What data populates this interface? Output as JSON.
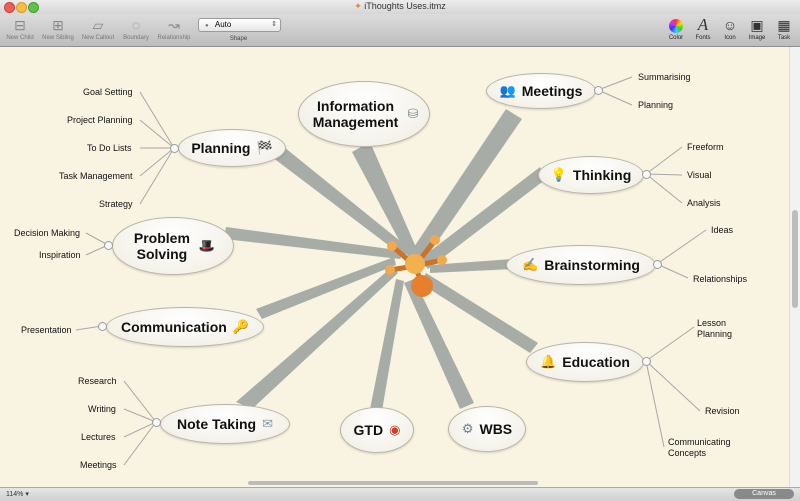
{
  "window": {
    "title": "iThoughts Uses.itmz"
  },
  "toolbar": {
    "new_child": "New Child",
    "new_sibling": "New Sibling",
    "new_callout": "New Callout",
    "boundary": "Boundary",
    "relationship": "Relationship",
    "shape_value": "Auto",
    "shape_label": "Shape",
    "color": "Color",
    "fonts": "Fonts",
    "icon": "Icon",
    "image": "Image",
    "task": "Task"
  },
  "mindmap": {
    "branches": {
      "information_management": {
        "label": "Information Management",
        "icon": "database-icon"
      },
      "meetings": {
        "label": "Meetings",
        "icon": "people-icon",
        "children": [
          "Summarising",
          "Planning"
        ]
      },
      "thinking": {
        "label": "Thinking",
        "icon": "lightbulb-icon",
        "children": [
          "Freeform",
          "Visual",
          "Analysis"
        ]
      },
      "brainstorming": {
        "label": "Brainstorming",
        "icon": "pencil-icon",
        "children": [
          "Ideas",
          "Relationships"
        ]
      },
      "education": {
        "label": "Education",
        "icon": "bell-icon",
        "children": [
          "Lesson Planning",
          "Revision",
          "Communicating Concepts"
        ]
      },
      "wbs": {
        "label": "WBS",
        "icon": "gear-icon"
      },
      "gtd": {
        "label": "GTD",
        "icon": "target-icon"
      },
      "note_taking": {
        "label": "Note Taking",
        "icon": "envelope-icon",
        "children": [
          "Research",
          "Writing",
          "Lectures",
          "Meetings"
        ]
      },
      "communication": {
        "label": "Communication",
        "icon": "key-icon",
        "children": [
          "Presentation"
        ]
      },
      "problem_solving": {
        "label": "Problem Solving",
        "icon": "bowler-hat-icon",
        "children": [
          "Decision Making",
          "Inspiration"
        ]
      },
      "planning": {
        "label": "Planning",
        "icon": "checkered-flag-icon",
        "children": [
          "Goal Setting",
          "Project Planning",
          "To Do Lists",
          "Task Management",
          "Strategy"
        ]
      }
    }
  },
  "status": {
    "zoom": "114%",
    "mode_button": "Canvas"
  },
  "colors": {
    "canvas": "#f9f3e1",
    "connector": "#a3aaa3",
    "central": "#e8973a"
  }
}
